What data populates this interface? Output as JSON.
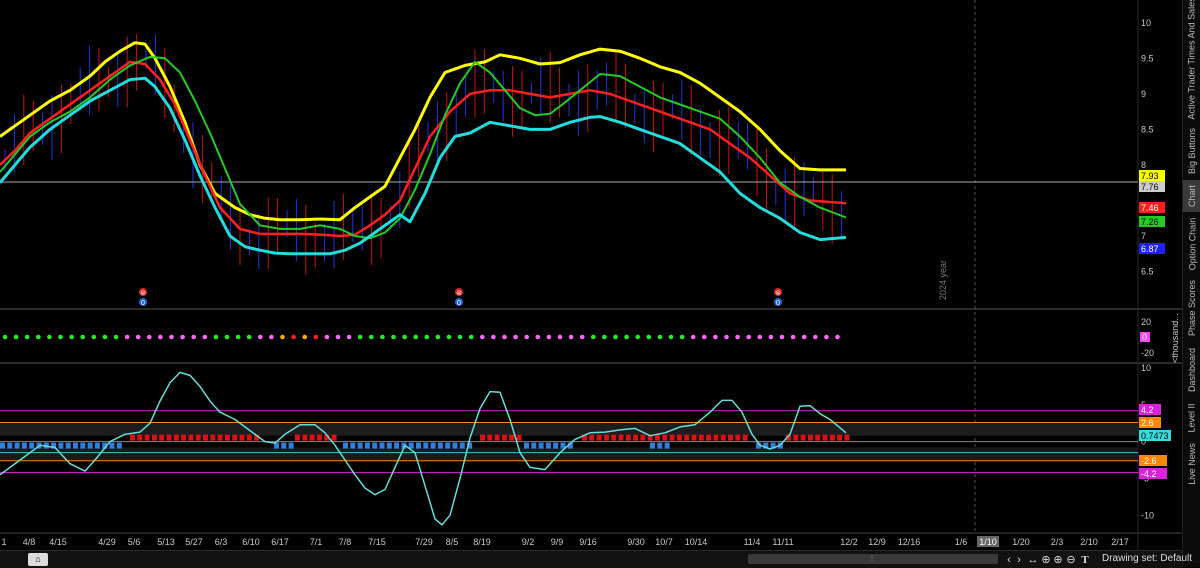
{
  "chart_data": [
    {
      "type": "line",
      "panel": "price",
      "y_axis": {
        "ticks": [
          10,
          9.5,
          9,
          8.5,
          8,
          7.5,
          7,
          6.5
        ],
        "tick_labels": [
          "10",
          "9.5",
          "9",
          "8.5",
          "8",
          "",
          "7",
          "6.5"
        ],
        "ylim": [
          6.1,
          10.25
        ]
      },
      "x_axis": {
        "tick_labels": [
          "1",
          "4/8",
          "4/15",
          "4/29",
          "5/6",
          "5/13",
          "5/27",
          "6/3",
          "6/10",
          "6/17",
          "7/1",
          "7/8",
          "7/15",
          "7/29",
          "8/5",
          "8/19",
          "9/2",
          "9/9",
          "9/16",
          "9/30",
          "10/7",
          "10/14",
          "11/4",
          "11/11",
          "12/2",
          "12/9",
          "12/16",
          "1/6",
          "1/10",
          "1/20",
          "2/3",
          "2/10",
          "2/17"
        ],
        "highlighted_label": "1/10"
      },
      "year_marker": "2024 year",
      "series": [
        {
          "color": "#ffff00",
          "x": [
            0,
            15,
            30,
            50,
            70,
            90,
            105,
            120,
            135,
            145,
            155,
            170,
            185,
            200,
            215,
            235,
            250,
            265,
            280,
            300,
            320,
            340,
            355,
            370,
            385,
            400,
            415,
            430,
            445,
            465,
            485,
            500,
            520,
            540,
            560,
            580,
            600,
            620,
            640,
            660,
            680,
            700,
            720,
            740,
            760,
            780,
            800,
            820,
            846
          ],
          "y": [
            8.4,
            8.55,
            8.7,
            8.9,
            9.05,
            9.25,
            9.45,
            9.6,
            9.72,
            9.7,
            9.5,
            9.1,
            8.6,
            8.0,
            7.6,
            7.4,
            7.3,
            7.25,
            7.23,
            7.23,
            7.24,
            7.23,
            7.4,
            7.55,
            7.7,
            8.1,
            8.5,
            8.95,
            9.3,
            9.4,
            9.45,
            9.55,
            9.5,
            9.42,
            9.44,
            9.55,
            9.63,
            9.6,
            9.5,
            9.38,
            9.3,
            9.15,
            8.95,
            8.75,
            8.5,
            8.2,
            7.95,
            7.93,
            7.93
          ]
        },
        {
          "color": "#ff2020",
          "x": [
            0,
            15,
            30,
            50,
            70,
            90,
            110,
            130,
            145,
            160,
            175,
            190,
            205,
            220,
            240,
            260,
            280,
            300,
            320,
            340,
            355,
            370,
            385,
            400,
            415,
            430,
            450,
            470,
            490,
            510,
            530,
            550,
            570,
            590,
            610,
            630,
            650,
            670,
            690,
            710,
            730,
            750,
            770,
            790,
            810,
            846
          ],
          "y": [
            8.0,
            8.2,
            8.45,
            8.65,
            8.85,
            9.05,
            9.25,
            9.45,
            9.42,
            9.2,
            8.85,
            8.35,
            7.85,
            7.4,
            7.1,
            7.03,
            7.03,
            7.03,
            7.02,
            7.0,
            7.02,
            7.15,
            7.3,
            7.5,
            7.95,
            8.4,
            8.75,
            9.0,
            9.05,
            9.05,
            9.0,
            8.95,
            9.0,
            9.05,
            9.0,
            8.9,
            8.8,
            8.7,
            8.6,
            8.5,
            8.3,
            8.1,
            7.85,
            7.6,
            7.5,
            7.46
          ]
        },
        {
          "color": "#22cc22",
          "x": [
            0,
            15,
            30,
            50,
            70,
            90,
            110,
            130,
            150,
            165,
            180,
            195,
            210,
            225,
            240,
            260,
            280,
            300,
            320,
            340,
            355,
            370,
            385,
            400,
            415,
            430,
            445,
            460,
            475,
            490,
            505,
            520,
            535,
            550,
            565,
            580,
            600,
            620,
            640,
            660,
            680,
            700,
            720,
            740,
            760,
            780,
            800,
            820,
            846
          ],
          "y": [
            7.9,
            8.15,
            8.4,
            8.6,
            8.75,
            8.95,
            9.2,
            9.4,
            9.52,
            9.5,
            9.3,
            8.9,
            8.45,
            7.95,
            7.45,
            7.15,
            7.1,
            7.1,
            7.15,
            7.1,
            7.0,
            6.97,
            7.05,
            7.25,
            7.65,
            8.15,
            8.7,
            9.15,
            9.45,
            9.3,
            9.05,
            8.8,
            8.7,
            8.72,
            8.88,
            9.05,
            9.28,
            9.25,
            9.1,
            8.95,
            8.85,
            8.75,
            8.65,
            8.4,
            8.1,
            7.75,
            7.55,
            7.4,
            7.26
          ]
        },
        {
          "color": "#22dddd",
          "x": [
            0,
            15,
            30,
            50,
            70,
            90,
            110,
            130,
            145,
            155,
            170,
            185,
            200,
            215,
            230,
            245,
            260,
            275,
            290,
            310,
            330,
            345,
            360,
            375,
            390,
            400,
            410,
            425,
            440,
            455,
            470,
            490,
            510,
            530,
            550,
            570,
            590,
            600,
            620,
            640,
            660,
            680,
            700,
            720,
            740,
            760,
            780,
            800,
            820,
            846
          ],
          "y": [
            7.75,
            8.0,
            8.25,
            8.5,
            8.7,
            8.9,
            9.05,
            9.2,
            9.22,
            9.1,
            8.8,
            8.35,
            7.85,
            7.4,
            7.0,
            6.85,
            6.8,
            6.76,
            6.75,
            6.75,
            6.75,
            6.8,
            6.9,
            7.05,
            7.2,
            7.3,
            7.2,
            7.6,
            8.1,
            8.4,
            8.45,
            8.6,
            8.55,
            8.5,
            8.5,
            8.6,
            8.67,
            8.68,
            8.6,
            8.5,
            8.4,
            8.3,
            8.1,
            7.9,
            7.6,
            7.4,
            7.25,
            7.05,
            6.95,
            6.98
          ]
        }
      ],
      "price_line": 7.76,
      "labels": [
        {
          "value": "7.93",
          "color": "#ffff00"
        },
        {
          "value": "7.76",
          "color": "#cccccc"
        },
        {
          "value": "7.46",
          "color": "#ff2020"
        },
        {
          "value": "7.26",
          "color": "#22cc22"
        },
        {
          "value": "6.87",
          "color": "#2020ff"
        }
      ]
    },
    {
      "type": "scatter",
      "panel": "phase",
      "y_axis": {
        "tick_labels": [
          "20",
          "0",
          "-20"
        ],
        "axis_title": "<thousand..."
      },
      "zero_label": "0",
      "dot_colors": [
        "#22ee22",
        "#22ee22",
        "#22ee22",
        "#22ee22",
        "#22ee22",
        "#22ee22",
        "#22ee22",
        "#22ee22",
        "#22ee22",
        "#22ee22",
        "#22ee22",
        "#ff66ff",
        "#ff66ff",
        "#ff66ff",
        "#ff66ff",
        "#ff66ff",
        "#ff66ff",
        "#ff66ff",
        "#ff66ff",
        "#22ee22",
        "#22ee22",
        "#22ee22",
        "#22ee22",
        "#ff66ff",
        "#ff66ff",
        "#ffaa00",
        "#ff2222",
        "#ffaa00",
        "#ff2222",
        "#ff66ff",
        "#ff66ff",
        "#ff66ff",
        "#22ee22",
        "#22ee22",
        "#22ee22",
        "#22ee22",
        "#22ee22",
        "#22ee22",
        "#22ee22",
        "#22ee22",
        "#22ee22",
        "#22ee22",
        "#22ee22",
        "#ff66ff",
        "#ff66ff",
        "#ff66ff",
        "#ff66ff",
        "#ff66ff",
        "#ff66ff",
        "#ff66ff",
        "#ff66ff",
        "#ff66ff",
        "#ff66ff",
        "#22ee22",
        "#22ee22",
        "#22ee22",
        "#22ee22",
        "#22ee22",
        "#22ee22",
        "#22ee22",
        "#22ee22",
        "#22ee22",
        "#ff66ff",
        "#ff66ff",
        "#ff66ff",
        "#ff66ff",
        "#ff66ff",
        "#ff66ff",
        "#ff66ff",
        "#ff66ff",
        "#ff66ff",
        "#ff66ff",
        "#ff66ff",
        "#ff66ff",
        "#ff66ff",
        "#ff66ff"
      ]
    },
    {
      "type": "line",
      "panel": "oscillator",
      "y_axis": {
        "tick_labels": [
          "10",
          "5",
          "0",
          "-5",
          "-10"
        ],
        "ylim": [
          -12,
          10
        ]
      },
      "levels": [
        {
          "value": 4.2,
          "color": "#dd22dd",
          "label": "4.2"
        },
        {
          "value": 2.6,
          "color": "#ff8800",
          "label": "2.6"
        },
        {
          "value": -2.6,
          "color": "#ff8800",
          "label": "-2.6"
        },
        {
          "value": -4.2,
          "color": "#dd22dd",
          "label": "-4.2"
        }
      ],
      "current_value": "0.7473",
      "series": [
        {
          "color": "#66dddd",
          "x": [
            0,
            10,
            25,
            40,
            55,
            70,
            85,
            95,
            110,
            125,
            140,
            150,
            160,
            170,
            180,
            190,
            200,
            210,
            220,
            235,
            250,
            265,
            275,
            285,
            300,
            315,
            325,
            335,
            345,
            355,
            365,
            375,
            385,
            395,
            405,
            415,
            425,
            435,
            442,
            450,
            460,
            470,
            480,
            490,
            500,
            510,
            520,
            530,
            545,
            560,
            575,
            590,
            605,
            620,
            635,
            650,
            665,
            680,
            695,
            710,
            722,
            732,
            742,
            752,
            760,
            770,
            780,
            790,
            800,
            810,
            820,
            830,
            846
          ],
          "y": [
            -4.5,
            -3.5,
            -2.0,
            -0.5,
            -0.8,
            -3.0,
            -4.0,
            -2.5,
            0.0,
            1.0,
            1.3,
            2.5,
            5.5,
            8.0,
            9.4,
            9.0,
            7.5,
            5.5,
            4.0,
            3.0,
            1.5,
            0.0,
            -0.2,
            1.0,
            2.3,
            2.3,
            1.2,
            -0.5,
            -2.5,
            -4.5,
            -6.3,
            -7.2,
            -6.5,
            -3.5,
            -0.5,
            -1.5,
            -6.0,
            -10.5,
            -11.3,
            -10.0,
            -5.0,
            0.5,
            4.5,
            6.8,
            6.7,
            3.0,
            -1.5,
            -3.5,
            -3.8,
            -1.5,
            0.3,
            1.2,
            1.3,
            1.6,
            1.8,
            0.8,
            1.2,
            2.0,
            2.3,
            4.0,
            5.6,
            5.6,
            4.0,
            1.0,
            -0.5,
            -1.0,
            -0.5,
            1.0,
            4.8,
            4.9,
            3.8,
            3.0,
            1.2
          ]
        }
      ],
      "histogram": {
        "blue_ranges": [
          [
            0,
            124
          ],
          [
            274,
            290
          ],
          [
            343,
            470
          ],
          [
            524,
            570
          ],
          [
            650,
            670
          ],
          [
            756,
            780
          ]
        ],
        "red_ranges": [
          [
            130,
            255
          ],
          [
            295,
            338
          ],
          [
            480,
            520
          ],
          [
            582,
            745
          ],
          [
            786,
            846
          ]
        ]
      }
    }
  ],
  "side_tabs": [
    "Times And Sales",
    "Active Trader",
    "Big Buttons",
    "Chart",
    "Option Chain",
    "Phase Scores",
    "Dashboard",
    "Level II",
    "Live News"
  ],
  "active_tab": "Chart",
  "bottom_bar": {
    "drawing_set": "Drawing set: Default"
  },
  "marker_glyphs": {
    "top": "⊜",
    "bottom": "0"
  },
  "colors": {
    "background": "#000000",
    "grid_line": "#2b2b2b",
    "price_line": "#aaaaaa"
  }
}
